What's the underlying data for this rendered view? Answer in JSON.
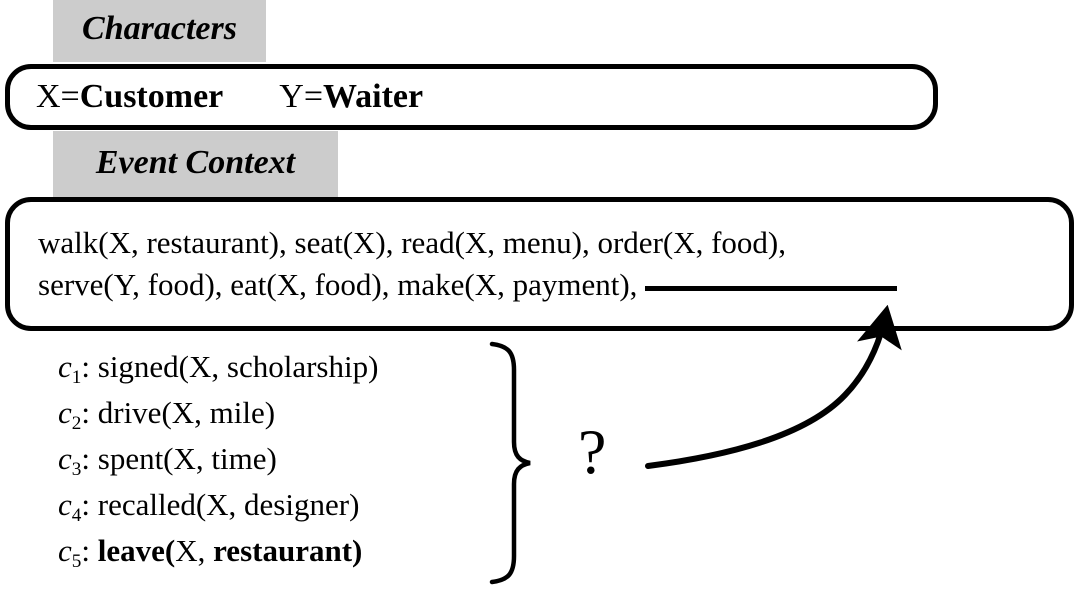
{
  "sections": {
    "characters": {
      "tab_label": "Characters",
      "entries": [
        {
          "variable": "X=",
          "value": "Customer"
        },
        {
          "variable": "Y=",
          "value": "Waiter"
        }
      ]
    },
    "event_context": {
      "tab_label": "Event Context",
      "line1": "walk(X, restaurant), seat(X), read(X, menu), order(X, food),",
      "line2": "serve(Y, food), eat(X, food), make(X, payment),",
      "blank_slot": ""
    }
  },
  "candidates": [
    {
      "id": "c",
      "index": "1",
      "colon": ":",
      "text": "signed(X, scholarship)",
      "bold": false
    },
    {
      "id": "c",
      "index": "2",
      "colon": ":",
      "text": "drive(X, mile)",
      "bold": false
    },
    {
      "id": "c",
      "index": "3",
      "colon": ":",
      "text": "spent(X, time)",
      "bold": false
    },
    {
      "id": "c",
      "index": "4",
      "colon": ":",
      "text": "recalled(X, designer)",
      "bold": false
    },
    {
      "id": "c",
      "index": "5",
      "colon": ":",
      "text_bold_head": "leave(",
      "text_plain": "X,",
      "text_bold_tail": " restaurant)",
      "bold": true
    }
  ],
  "annotation": {
    "question_mark": "?",
    "brace_icon": "right-curly-brace",
    "arrow_icon": "curved-arrow-up"
  },
  "colors": {
    "tab_background": "#cccccc",
    "stroke": "#000000",
    "page_background": "#ffffff"
  }
}
